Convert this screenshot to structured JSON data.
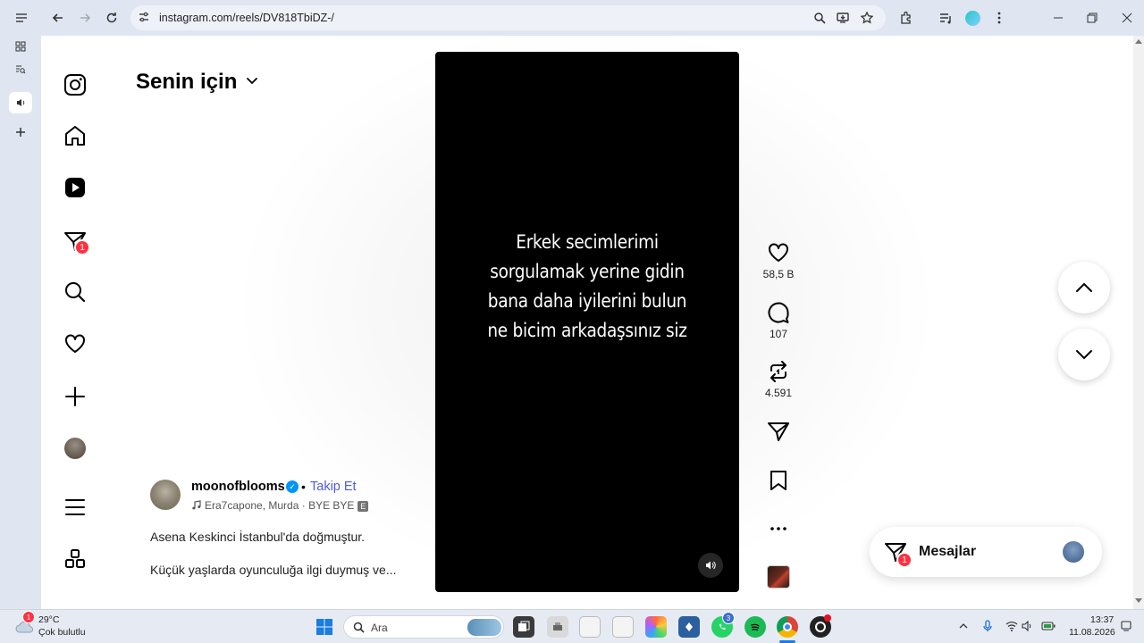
{
  "browser": {
    "url": "instagram.com/reels/DV818TbiDZ-/"
  },
  "nav": {
    "notification_count": "1"
  },
  "feed": {
    "title": "Senin için"
  },
  "video": {
    "lines": [
      "Erkek secimlerimi",
      "sorgulamak yerine gidin",
      "bana daha iyilerini bulun",
      "ne bicim arkadaşsınız siz"
    ]
  },
  "actions": {
    "likes": "58,5 B",
    "comments": "107",
    "reposts": "4.591"
  },
  "post": {
    "username": "moonofblooms",
    "separator": "•",
    "follow_label": "Takip Et",
    "music": "Era7capone, Murda · BYE BYE",
    "explicit_badge": "E",
    "caption_line1": "Asena Keskinci İstanbul'da doğmuştur.",
    "caption_line2": "Küçük yaşlarda oyunculuğa ilgi duymuş ve..."
  },
  "messages": {
    "label": "Mesajlar",
    "count": "1"
  },
  "taskbar": {
    "weather_temp": "29°C",
    "weather_desc": "Çok bulutlu",
    "weather_badge": "1",
    "search_label": "Ara",
    "whatsapp_badge": "3",
    "time": "13:37",
    "date": "11.08.2026"
  },
  "colors": {
    "accent_blue": "#4a5ce8",
    "badge_red": "#ff3040",
    "verified_blue": "#0095f6"
  }
}
